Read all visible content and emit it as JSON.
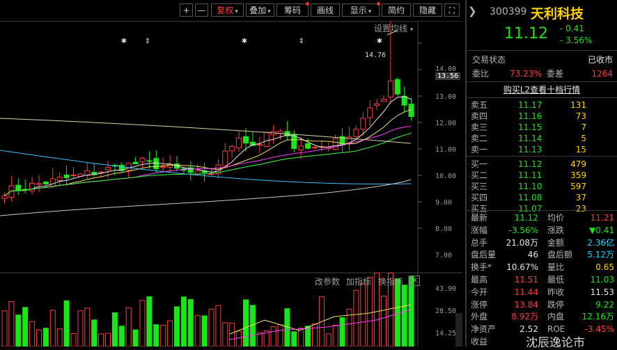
{
  "toolbar": {
    "plus": "+",
    "minus": "—",
    "fuquan": "复权",
    "diejia": "叠加",
    "chouma": "筹码",
    "huaxian": "画线",
    "xianshi": "显示",
    "jianyue": "简约",
    "yincang": "隐藏",
    "expand": "⛶"
  },
  "chart": {
    "settings_label": "设置均线",
    "peak_label": "14.76",
    "current_price_tag": "13.56",
    "y_ticks": [
      "14.00",
      "13.00",
      "12.00",
      "11.00",
      "10.00",
      "9.00",
      "8.00",
      "7.00"
    ],
    "vol_ticks": [
      "43.90",
      "28.50",
      "14.25"
    ],
    "indicator_links": [
      "改参数",
      "加指标",
      "换指标"
    ],
    "indicator_close": "✕",
    "marker_symbols": [
      "✱",
      "⇕",
      "✱",
      "⇕",
      "✱"
    ]
  },
  "panel": {
    "code": "300399",
    "name": "天利科技",
    "price": "11.12",
    "change": "- 0.41",
    "change_pct": "- 3.56%",
    "trade_status_label": "交易状态",
    "trade_status_value": "已收市",
    "weibi_label": "委比",
    "weibi_value": "73.23%",
    "weicha_label": "委差",
    "weicha_value": "1264",
    "l2_link": "购买L2查看十档行情",
    "sell": [
      {
        "label": "卖五",
        "price": "11.17",
        "vol": "131"
      },
      {
        "label": "卖四",
        "price": "11.16",
        "vol": "73"
      },
      {
        "label": "卖三",
        "price": "11.15",
        "vol": "7"
      },
      {
        "label": "卖二",
        "price": "11.14",
        "vol": "5"
      },
      {
        "label": "卖一",
        "price": "11.13",
        "vol": "15"
      }
    ],
    "buy": [
      {
        "label": "买一",
        "price": "11.12",
        "vol": "479"
      },
      {
        "label": "买二",
        "price": "11.11",
        "vol": "359"
      },
      {
        "label": "买三",
        "price": "11.10",
        "vol": "597"
      },
      {
        "label": "买四",
        "price": "11.08",
        "vol": "37"
      },
      {
        "label": "买五",
        "price": "11.07",
        "vol": "23"
      }
    ],
    "stats": [
      {
        "l1": "最新",
        "v1": "11.12",
        "l2": "均价",
        "v2": "11.21"
      },
      {
        "l1": "涨幅",
        "v1": "-3.56%",
        "l2": "涨跌",
        "v2": "▼0.41"
      },
      {
        "l1": "总手",
        "v1": "21.08万",
        "l2": "金额",
        "v2": "2.36亿"
      },
      {
        "l1": "盘后量",
        "v1": "46",
        "l2": "盘后额",
        "v2": "5.12万"
      },
      {
        "l1": "换手*",
        "v1": "10.67%",
        "l2": "量比",
        "v2": "0.65"
      },
      {
        "l1": "最高",
        "v1": "11.51",
        "l2": "最低",
        "v2": "11.03"
      },
      {
        "l1": "今开",
        "v1": "11.44",
        "l2": "昨收",
        "v2": "11.53"
      },
      {
        "l1": "涨停",
        "v1": "13.84",
        "l2": "跌停",
        "v2": "9.22"
      },
      {
        "l1": "外盘",
        "v1": "8.92万",
        "l2": "内盘",
        "v2": "12.16万"
      },
      {
        "l1": "净资产",
        "v1": "2.52",
        "l2": "ROE",
        "v2": "-3.45%"
      },
      {
        "l1": "收益",
        "v1": "",
        "l2": "",
        "v2": ""
      }
    ],
    "watermark": "沈辰逸论市"
  },
  "colors": {
    "up": "#ff3b3b",
    "down": "#19e619",
    "ma_white": "#e8e8e8",
    "ma_yellow": "#f0e060",
    "ma_magenta": "#ff40ff",
    "ma_green": "#40ff40",
    "ma_cyan": "#40c0ff",
    "ma_khaki": "#d8d8a0"
  }
}
